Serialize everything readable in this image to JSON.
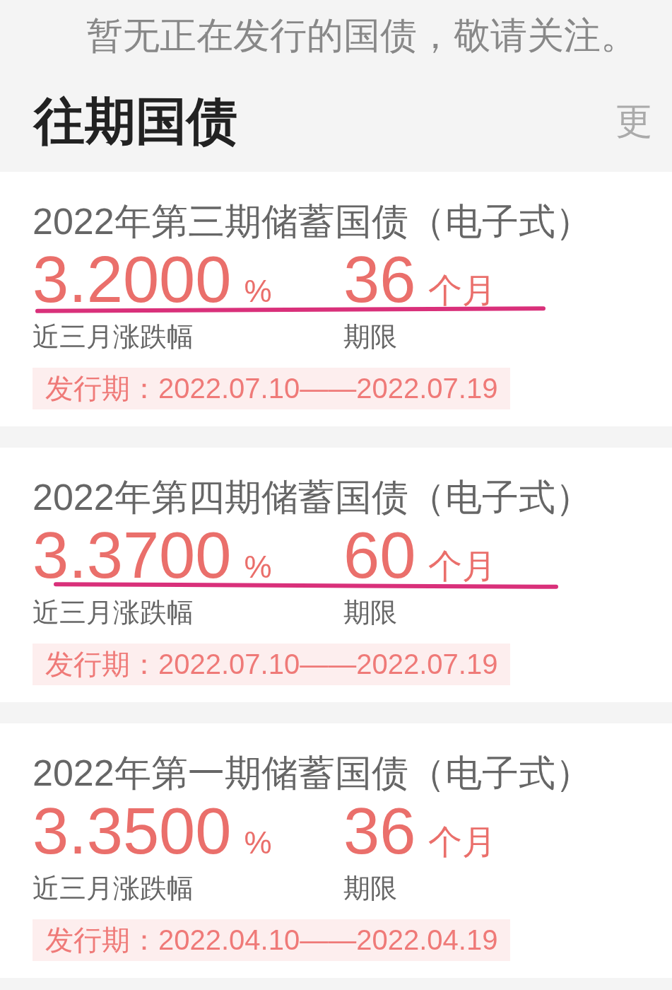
{
  "notice": "暂无正在发行的国债，敬请关注。",
  "section": {
    "title": "往期国债",
    "more": "更"
  },
  "bonds": [
    {
      "title": "2022年第三期储蓄国债（电子式）",
      "rate": "3.2000",
      "rate_unit": "%",
      "term": "36",
      "term_unit": "个月",
      "rate_label": "近三月涨跌幅",
      "term_label": "期限",
      "period": "发行期：2022.07.10——2022.07.19",
      "underlined": true
    },
    {
      "title": "2022年第四期储蓄国债（电子式）",
      "rate": "3.3700",
      "rate_unit": "%",
      "term": "60",
      "term_unit": "个月",
      "rate_label": "近三月涨跌幅",
      "term_label": "期限",
      "period": "发行期：2022.07.10——2022.07.19",
      "underlined": true
    },
    {
      "title": "2022年第一期储蓄国债（电子式）",
      "rate": "3.3500",
      "rate_unit": "%",
      "term": "36",
      "term_unit": "个月",
      "rate_label": "近三月涨跌幅",
      "term_label": "期限",
      "period": "发行期：2022.04.10——2022.04.19",
      "underlined": false
    }
  ]
}
